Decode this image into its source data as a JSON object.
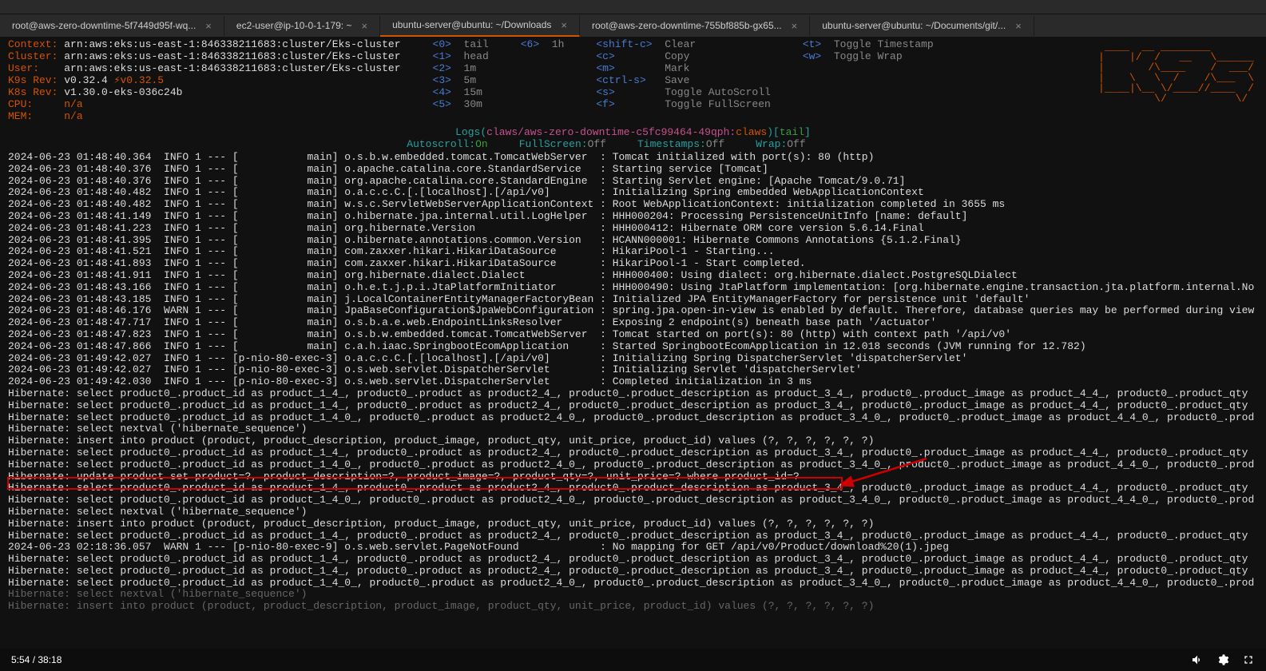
{
  "tabs": [
    {
      "label": "root@aws-zero-downtime-5f7449d95f-wq...",
      "active": false
    },
    {
      "label": "ec2-user@ip-10-0-1-179: ~",
      "active": false
    },
    {
      "label": "ubuntu-server@ubuntu: ~/Downloads",
      "active": true
    },
    {
      "label": "root@aws-zero-downtime-755bf885b-gx65...",
      "active": false
    },
    {
      "label": "ubuntu-server@ubuntu: ~/Documents/git/...",
      "active": false
    }
  ],
  "context": {
    "labels": {
      "context": "Context:",
      "cluster": "Cluster:",
      "user": "User:",
      "k9s_rev": "K9s Rev:",
      "k8s_rev": "K8s Rev:",
      "cpu": "CPU:",
      "mem": "MEM:"
    },
    "values": {
      "context": "arn:aws:eks:us-east-1:846338211683:cluster/Eks-cluster",
      "cluster": "arn:aws:eks:us-east-1:846338211683:cluster/Eks-cluster",
      "user": "arn:aws:eks:us-east-1:846338211683:cluster/Eks-cluster",
      "k9s_rev": "v0.32.4",
      "k9s_rev_note": "⚡v0.32.5",
      "k8s_rev": "v1.30.0-eks-036c24b",
      "cpu": "n/a",
      "mem": "n/a"
    }
  },
  "shortcuts": {
    "col1": [
      {
        "key": "<0>",
        "label": "tail"
      },
      {
        "key": "<1>",
        "label": "head"
      },
      {
        "key": "<2>",
        "label": "1m"
      },
      {
        "key": "<3>",
        "label": "5m"
      },
      {
        "key": "<4>",
        "label": "15m"
      },
      {
        "key": "<5>",
        "label": "30m"
      }
    ],
    "col2": [
      {
        "key": "<6>",
        "label": "1h"
      }
    ],
    "col3": [
      {
        "key": "<shift-c>",
        "label": "Clear"
      },
      {
        "key": "<c>",
        "label": "Copy"
      },
      {
        "key": "<m>",
        "label": "Mark"
      },
      {
        "key": "<ctrl-s>",
        "label": "Save"
      },
      {
        "key": "<s>",
        "label": "Toggle AutoScroll"
      },
      {
        "key": "<f>",
        "label": "Toggle FullScreen"
      }
    ],
    "col4": [
      {
        "key": "<t>",
        "label": "Toggle Timestamp"
      },
      {
        "key": "<w>",
        "label": "Toggle Wrap"
      }
    ]
  },
  "logs_header": {
    "prefix": "Logs(",
    "path": "claws/aws-zero-downtime-c5fc99464-49qph:",
    "container": "claws",
    "suffix": ")[",
    "mode": "tail",
    "end": "]"
  },
  "status": {
    "autoscroll_label": "Autoscroll:",
    "autoscroll": "On",
    "fullscreen_label": "FullScreen:",
    "fullscreen": "Off",
    "timestamps_label": "Timestamps:",
    "timestamps": "Off",
    "wrap_label": "Wrap:",
    "wrap": "Off"
  },
  "log_lines": [
    "2024-06-23 01:48:40.364  INFO 1 --- [           main] o.s.b.w.embedded.tomcat.TomcatWebServer  : Tomcat initialized with port(s): 80 (http)",
    "2024-06-23 01:48:40.376  INFO 1 --- [           main] o.apache.catalina.core.StandardService   : Starting service [Tomcat]",
    "2024-06-23 01:48:40.376  INFO 1 --- [           main] org.apache.catalina.core.StandardEngine  : Starting Servlet engine: [Apache Tomcat/9.0.71]",
    "2024-06-23 01:48:40.482  INFO 1 --- [           main] o.a.c.c.C.[.[localhost].[/api/v0]        : Initializing Spring embedded WebApplicationContext",
    "2024-06-23 01:48:40.482  INFO 1 --- [           main] w.s.c.ServletWebServerApplicationContext : Root WebApplicationContext: initialization completed in 3655 ms",
    "2024-06-23 01:48:41.149  INFO 1 --- [           main] o.hibernate.jpa.internal.util.LogHelper  : HHH000204: Processing PersistenceUnitInfo [name: default]",
    "2024-06-23 01:48:41.223  INFO 1 --- [           main] org.hibernate.Version                    : HHH000412: Hibernate ORM core version 5.6.14.Final",
    "2024-06-23 01:48:41.395  INFO 1 --- [           main] o.hibernate.annotations.common.Version   : HCANN000001: Hibernate Commons Annotations {5.1.2.Final}",
    "2024-06-23 01:48:41.521  INFO 1 --- [           main] com.zaxxer.hikari.HikariDataSource       : HikariPool-1 - Starting...",
    "2024-06-23 01:48:41.893  INFO 1 --- [           main] com.zaxxer.hikari.HikariDataSource       : HikariPool-1 - Start completed.",
    "2024-06-23 01:48:41.911  INFO 1 --- [           main] org.hibernate.dialect.Dialect            : HHH000400: Using dialect: org.hibernate.dialect.PostgreSQLDialect",
    "2024-06-23 01:48:43.166  INFO 1 --- [           main] o.h.e.t.j.p.i.JtaPlatformInitiator       : HHH000490: Using JtaPlatform implementation: [org.hibernate.engine.transaction.jta.platform.internal.No",
    "2024-06-23 01:48:43.185  INFO 1 --- [           main] j.LocalContainerEntityManagerFactoryBean : Initialized JPA EntityManagerFactory for persistence unit 'default'",
    "2024-06-23 01:48:46.176  WARN 1 --- [           main] JpaBaseConfiguration$JpaWebConfiguration : spring.jpa.open-in-view is enabled by default. Therefore, database queries may be performed during view",
    "2024-06-23 01:48:47.717  INFO 1 --- [           main] o.s.b.a.e.web.EndpointLinksResolver      : Exposing 2 endpoint(s) beneath base path '/actuator'",
    "2024-06-23 01:48:47.823  INFO 1 --- [           main] o.s.b.w.embedded.tomcat.TomcatWebServer  : Tomcat started on port(s): 80 (http) with context path '/api/v0'",
    "2024-06-23 01:48:47.866  INFO 1 --- [           main] c.a.h.iaac.SpringbootEcomApplication     : Started SpringbootEcomApplication in 12.018 seconds (JVM running for 12.782)",
    "2024-06-23 01:49:42.027  INFO 1 --- [p-nio-80-exec-3] o.a.c.c.C.[.[localhost].[/api/v0]        : Initializing Spring DispatcherServlet 'dispatcherServlet'",
    "2024-06-23 01:49:42.027  INFO 1 --- [p-nio-80-exec-3] o.s.web.servlet.DispatcherServlet        : Initializing Servlet 'dispatcherServlet'",
    "2024-06-23 01:49:42.030  INFO 1 --- [p-nio-80-exec-3] o.s.web.servlet.DispatcherServlet        : Completed initialization in 3 ms",
    "Hibernate: select product0_.product_id as product_1_4_, product0_.product as product2_4_, product0_.product_description as product_3_4_, product0_.product_image as product_4_4_, product0_.product_qty",
    "Hibernate: select product0_.product_id as product_1_4_, product0_.product as product2_4_, product0_.product_description as product_3_4_, product0_.product_image as product_4_4_, product0_.product_qty",
    "Hibernate: select product0_.product_id as product_1_4_0_, product0_.product as product2_4_0_, product0_.product_description as product_3_4_0_, product0_.product_image as product_4_4_0_, product0_.prod",
    "Hibernate: select nextval ('hibernate_sequence')",
    "Hibernate: insert into product (product, product_description, product_image, product_qty, unit_price, product_id) values (?, ?, ?, ?, ?, ?)",
    "Hibernate: select product0_.product_id as product_1_4_, product0_.product as product2_4_, product0_.product_description as product_3_4_, product0_.product_image as product_4_4_, product0_.product_qty",
    "Hibernate: select product0_.product_id as product_1_4_0_, product0_.product as product2_4_0_, product0_.product_description as product_3_4_0_, product0_.product_image as product_4_4_0_, product0_.prod",
    "Hibernate: update product set product=?, product_description=?, product_image=?, product_qty=?, unit_price=? where product_id=?",
    "Hibernate: select product0_.product_id as product_1_4_, product0_.product as product2_4_, product0_.product_description as product_3_4_, product0_.product_image as product_4_4_, product0_.product_qty",
    "Hibernate: select product0_.product_id as product_1_4_0_, product0_.product as product2_4_0_, product0_.product_description as product_3_4_0_, product0_.product_image as product_4_4_0_, product0_.prod",
    "Hibernate: select nextval ('hibernate_sequence')",
    "Hibernate: insert into product (product, product_description, product_image, product_qty, unit_price, product_id) values (?, ?, ?, ?, ?, ?)",
    "Hibernate: select product0_.product_id as product_1_4_, product0_.product as product2_4_, product0_.product_description as product_3_4_, product0_.product_image as product_4_4_, product0_.product_qty",
    "2024-06-23 02:18:36.057  WARN 1 --- [p-nio-80-exec-9] o.s.web.servlet.PageNotFound             : No mapping for GET /api/v0/Product/download%20(1).jpeg",
    "Hibernate: select product0_.product_id as product_1_4_, product0_.product as product2_4_, product0_.product_description as product_3_4_, product0_.product_image as product_4_4_, product0_.product_qty",
    "Hibernate: select product0_.product_id as product_1_4_, product0_.product as product2_4_, product0_.product_description as product_3_4_, product0_.product_image as product_4_4_, product0_.product_qty",
    "Hibernate: select product0_.product_id as product_1_4_0_, product0_.product as product2_4_0_, product0_.product_description as product_3_4_0_, product0_.product_image as product_4_4_0_, product0_.prod"
  ],
  "dim_lines": [
    "Hibernate: select nextval ('hibernate_sequence')",
    "Hibernate: insert into product (product, product_description, product_image, product_qty, unit_price, product_id) values (?, ?, ?, ?, ?, ?)"
  ],
  "video": {
    "time": "5:54 / 38:18"
  },
  "k9s_logo": " ____  __ ________       \n|    |/  /   __   \\______\n|       /\\____    /  ___/\n|    \\   \\  /    /\\___  \\\n|____|\\__ \\/____//____  /\n         \\/           \\/ "
}
